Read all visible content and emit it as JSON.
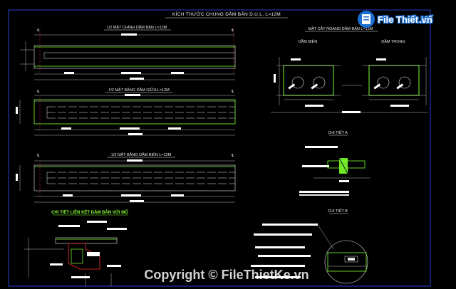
{
  "drawing": {
    "main_title": "KÍCH THƯỚC CHUNG DẦM BẢN D.U.L, L=12M",
    "views": [
      {
        "title": "1/2 MẶT CHÍNH DẦM BẢN L=12M"
      },
      {
        "title": "1/2 MẶT BẰNG DẦM GIỮA L=12M"
      },
      {
        "title": "1/2 MẶT BẰNG DẦM BIÊN L=12M"
      }
    ],
    "section_title": "MẶT CẮT NGANG DẦM BẢN L=12M",
    "section_left": "DẦM BIÊN",
    "section_right": "DẦM TRONG",
    "detail_a": "CHI TIẾT A",
    "detail_b": "CHI TIẾT B",
    "detail_connection": "CHI TIẾT LIÊN KẾT DẦM BẢN VỚI MỐ",
    "centerline_symbol": "℄"
  },
  "watermark": {
    "logo_text": "File Thiết Kế",
    "logo_suffix": ".vn",
    "copyright": "Copyright © FileThietKe.vn"
  },
  "colors": {
    "background": "#000000",
    "line_white": "#e8e8e8",
    "line_green": "#7cff2e",
    "line_red": "#ff3030",
    "frame_blue": "#3050ff",
    "logo_blue": "#1a6fd1"
  }
}
